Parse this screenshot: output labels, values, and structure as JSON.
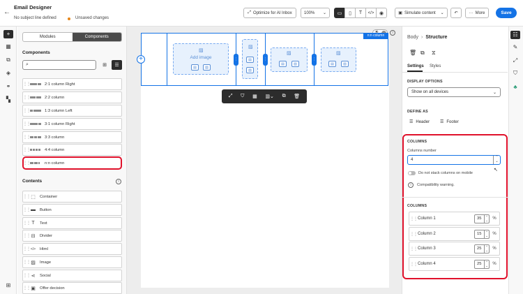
{
  "header": {
    "title": "Email Designer",
    "subject": "No subject line defined",
    "status": "Unsaved changes",
    "optimize_label": "Optimize for AI Inbox",
    "zoom": "100%",
    "simulate_label": "Simulate content",
    "more_label": "More",
    "save_label": "Save"
  },
  "left_panel": {
    "tabs": [
      "Modules",
      "Components"
    ],
    "active_tab": "Components",
    "components_title": "Components",
    "search_placeholder": "",
    "structures": [
      {
        "label": "2:1 column Right",
        "ratio": [
          2,
          1
        ]
      },
      {
        "label": "2:2 column",
        "ratio": [
          1,
          1
        ]
      },
      {
        "label": "1:3 column Left",
        "ratio": [
          1,
          3
        ]
      },
      {
        "label": "3:1 column Right",
        "ratio": [
          3,
          1
        ]
      },
      {
        "label": "3:3 column",
        "ratio": [
          1,
          1,
          1
        ]
      },
      {
        "label": "4:4 column",
        "ratio": [
          1,
          1,
          1,
          1
        ]
      },
      {
        "label": "n:n column",
        "ratio": [
          1,
          1,
          0.5
        ]
      }
    ],
    "contents_title": "Contents",
    "contents": [
      {
        "label": "Container",
        "icon": "container-icon",
        "glyph": "⬚"
      },
      {
        "label": "Button",
        "icon": "button-icon",
        "glyph": "▬"
      },
      {
        "label": "Text",
        "icon": "text-icon",
        "glyph": "T"
      },
      {
        "label": "Divider",
        "icon": "divider-icon",
        "glyph": "⊟"
      },
      {
        "label": "Html",
        "icon": "html-icon",
        "glyph": "</>"
      },
      {
        "label": "Image",
        "icon": "image-icon",
        "glyph": "▨"
      },
      {
        "label": "Social",
        "icon": "social-icon",
        "glyph": "⋖"
      },
      {
        "label": "Offer decision",
        "icon": "offer-decision-icon",
        "glyph": "▣"
      }
    ]
  },
  "canvas": {
    "add_image_label": "Add image",
    "structure_tag": "n:n column"
  },
  "right_panel": {
    "breadcrumb_parent": "Body",
    "breadcrumb_current": "Structure",
    "tabs": [
      "Settings",
      "Styles"
    ],
    "active_tab": "Settings",
    "display_options_label": "DISPLAY OPTIONS",
    "display_options_value": "Show on all devices",
    "define_as_label": "DEFINE AS",
    "define_header": "Header",
    "define_footer": "Footer",
    "columns_label": "COLUMNS",
    "columns_number_label": "Columns number",
    "columns_number_value": "4",
    "no_stack_label": "Do not stack columns on mobile",
    "compat_warning": "Compatibility warning.",
    "columns_list_label": "COLUMNS",
    "columns": [
      {
        "name": "Column 1",
        "value": "35",
        "unit": "%"
      },
      {
        "name": "Column 2",
        "value": "15",
        "unit": "%"
      },
      {
        "name": "Column 3",
        "value": "25",
        "unit": "%"
      },
      {
        "name": "Column 4",
        "value": "25",
        "unit": "%"
      }
    ]
  },
  "colors": {
    "accent": "#1473e6",
    "highlight": "#e0112b",
    "warning_dot": "#e68619"
  }
}
